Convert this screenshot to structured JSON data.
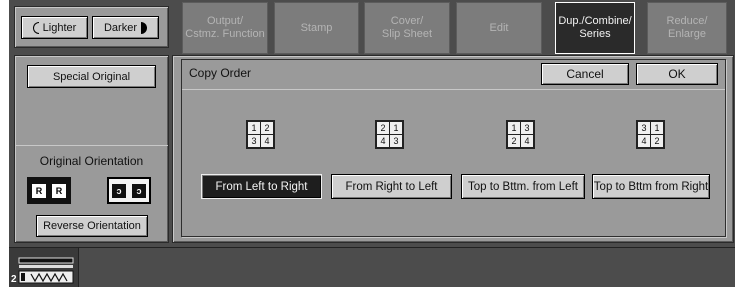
{
  "density": {
    "lighter_label": "Lighter",
    "darker_label": "Darker"
  },
  "special_original": {
    "label": "Special Original"
  },
  "orientation": {
    "title": "Original Orientation",
    "icon_1_glyph": "R",
    "icon_2_glyph": "ɔ",
    "reverse_label": "Reverse Orientation"
  },
  "tabs": [
    {
      "label_1": "Output/",
      "label_2": "Cstmz. Function"
    },
    {
      "label_1": "Stamp",
      "label_2": ""
    },
    {
      "label_1": "Cover/",
      "label_2": "Slip Sheet"
    },
    {
      "label_1": "Edit",
      "label_2": ""
    },
    {
      "label_1": "Dup./Combine/",
      "label_2": "Series"
    },
    {
      "label_1": "Reduce/",
      "label_2": "Enlarge"
    }
  ],
  "copy_order": {
    "title": "Copy Order",
    "cancel_label": "Cancel",
    "ok_label": "OK",
    "options": [
      {
        "label": "From Left to Right",
        "grid": [
          "1",
          "2",
          "3",
          "4"
        ],
        "selected": true
      },
      {
        "label": "From Right to Left",
        "grid": [
          "2",
          "1",
          "4",
          "3"
        ],
        "selected": false
      },
      {
        "label": "Top to Bttm. from Left",
        "grid": [
          "1",
          "3",
          "2",
          "4"
        ],
        "selected": false
      },
      {
        "label": "Top to Bttm from Right",
        "grid": [
          "3",
          "1",
          "4",
          "2"
        ],
        "selected": false
      }
    ]
  },
  "status": {
    "tray_number": "2"
  },
  "colors": {
    "screen_bg": "#4c4c4c",
    "panel_bg": "#9a9a9a",
    "selected_bg": "#1e1e1e",
    "tab_active_bg": "#2a2a2a"
  }
}
